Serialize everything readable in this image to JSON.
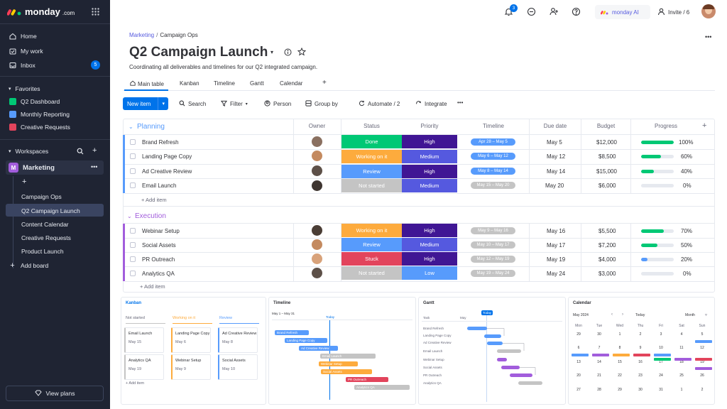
{
  "sidebar": {
    "logo": "monday",
    "logo_suffix": ".com",
    "nav": [
      {
        "label": "Home",
        "icon": "home-icon"
      },
      {
        "label": "My work",
        "icon": "calendar-check-icon"
      },
      {
        "label": "Inbox",
        "icon": "inbox-icon",
        "count": "5"
      }
    ],
    "favorites_label": "Favorites",
    "favorites": [
      {
        "label": "Q2 Dashboard",
        "color": "#00c875"
      },
      {
        "label": "Monthly Reporting",
        "color": "#579bfc"
      },
      {
        "label": "Creative Requests",
        "color": "#e2445c"
      }
    ],
    "workspaces_label": "Workspaces",
    "workspace_badge": "M",
    "workspace_name": "Marketing",
    "boards": [
      "Campaign Ops",
      "Q2 Campaign Launch",
      "Content Calendar",
      "Creative Requests",
      "Product Launch"
    ],
    "add_board": "Add board",
    "view_plans": "View plans"
  },
  "topbar": {
    "notif_count": "3",
    "ai_label": "monday AI",
    "invite_label": "Invite / 6"
  },
  "board": {
    "breadcrumb_parent": "Marketing",
    "breadcrumb_sep": "/",
    "breadcrumb_current": "Campaign Ops",
    "title": "Q2 Campaign Launch",
    "description": "Coordinating all deliverables and timelines for our Q2 integrated campaign.",
    "tabs": [
      "Main table",
      "Kanban",
      "Timeline",
      "Gantt",
      "Calendar",
      "+"
    ],
    "toolbar": {
      "new_item": "New item",
      "search": "Search",
      "filter": "Filter",
      "person": "Person",
      "group_by": "Group by",
      "automate": "Automate / 2",
      "integrate": "Integrate"
    },
    "columns": [
      "Owner",
      "Status",
      "Priority",
      "Timeline",
      "Due date",
      "Budget",
      "Progress"
    ],
    "add_item": "+ Add item",
    "groups": [
      {
        "name": "Planning",
        "color": "#579bfc",
        "rows": [
          {
            "name": "Brand Refresh",
            "status": "Done",
            "status_color": "#00c875",
            "priority": "High",
            "priority_color": "#401694",
            "timeline": "Apr 28 – May 5",
            "timeline_color": "#579bfc",
            "due": "May 5",
            "budget": "$12,000",
            "progress_label": "100%",
            "progress": 1.0
          },
          {
            "name": "Landing Page Copy",
            "status": "Working on it",
            "status_color": "#fdab3d",
            "priority": "Medium",
            "priority_color": "#5559df",
            "timeline": "May 6 – May 12",
            "timeline_color": "#579bfc",
            "due": "May 12",
            "budget": "$8,500",
            "progress_label": "60%",
            "progress": 0.6
          },
          {
            "name": "Ad Creative Review",
            "status": "Review",
            "status_color": "#579bfc",
            "priority": "High",
            "priority_color": "#401694",
            "timeline": "May 8 – May 14",
            "timeline_color": "#579bfc",
            "due": "May 14",
            "budget": "$15,000",
            "progress_label": "40%",
            "progress": 0.4
          },
          {
            "name": "Email Launch",
            "status": "Not started",
            "status_color": "#c4c4c4",
            "priority": "Medium",
            "priority_color": "#5559df",
            "timeline": "May 15 – May 20",
            "timeline_color": "#c4c4c4",
            "due": "May 20",
            "budget": "$6,000",
            "progress_label": "0%",
            "progress": 0
          }
        ]
      },
      {
        "name": "Execution",
        "color": "#a25ddc",
        "rows": [
          {
            "name": "Webinar Setup",
            "status": "Working on it",
            "status_color": "#fdab3d",
            "priority": "High",
            "priority_color": "#401694",
            "timeline": "May 9 – May 16",
            "timeline_color": "#c4c4c4",
            "due": "May 16",
            "budget": "$5,500",
            "progress_label": "70%",
            "progress": 0.7
          },
          {
            "name": "Social Assets",
            "status": "Review",
            "status_color": "#579bfc",
            "priority": "Medium",
            "priority_color": "#5559df",
            "timeline": "May 10 – May 17",
            "timeline_color": "#c4c4c4",
            "due": "May 17",
            "budget": "$7,200",
            "progress_label": "50%",
            "progress": 0.5
          },
          {
            "name": "PR Outreach",
            "status": "Stuck",
            "status_color": "#e2445c",
            "priority": "High",
            "priority_color": "#401694",
            "timeline": "May 12 – May 19",
            "timeline_color": "#c4c4c4",
            "due": "May 19",
            "budget": "$4,000",
            "progress_label": "20%",
            "progress": 0.2
          },
          {
            "name": "Analytics QA",
            "status": "Not started",
            "status_color": "#c4c4c4",
            "priority": "Low",
            "priority_color": "#579bfc",
            "timeline": "May 19 – May 24",
            "timeline_color": "#c4c4c4",
            "due": "May 24",
            "budget": "$3,000",
            "progress_label": "0%",
            "progress": 0
          }
        ]
      }
    ]
  },
  "previews": {
    "kanban": {
      "title": "Kanban",
      "columns": [
        {
          "label": "Not started",
          "color": "#676879",
          "cards": [
            {
              "name": "Email Launch",
              "date": "May 15"
            },
            {
              "name": "Analytics QA",
              "date": "May 19"
            }
          ]
        },
        {
          "label": "Working on it",
          "color": "#fdab3d",
          "cards": [
            {
              "name": "Landing Page Copy",
              "date": "May 6"
            },
            {
              "name": "Webinar Setup",
              "date": "May 9"
            }
          ]
        },
        {
          "label": "Review",
          "color": "#579bfc",
          "cards": [
            {
              "name": "Ad Creative Review",
              "date": "May 8"
            },
            {
              "name": "Social Assets",
              "date": "May 10"
            }
          ]
        }
      ],
      "add_item": "+ Add item"
    },
    "timeline": {
      "title": "Timeline",
      "range": "May 1 – May 31",
      "today": "Today",
      "bars": [
        {
          "name": "Brand Refresh",
          "color": "#579bfc"
        },
        {
          "name": "Landing Page Copy",
          "color": "#579bfc"
        },
        {
          "name": "Ad Creative Review",
          "color": "#579bfc"
        },
        {
          "name": "Email Launch",
          "color": "#c4c4c4"
        },
        {
          "name": "Webinar Setup",
          "color": "#fdab3d"
        },
        {
          "name": "Social Assets",
          "color": "#fdab3d"
        },
        {
          "name": "PR Outreach",
          "color": "#e2445c"
        },
        {
          "name": "Analytics QA",
          "color": "#c4c4c4"
        }
      ]
    },
    "gantt": {
      "title": "Gantt",
      "task_label": "Task",
      "today": "Today",
      "month": "May",
      "tasks": [
        "Brand Refresh",
        "Landing Page Copy",
        "Ad Creative Review",
        "Email Launch",
        "Webinar Setup",
        "Social Assets",
        "PR Outreach",
        "Analytics QA"
      ]
    },
    "calendar": {
      "title": "Calendar",
      "month": "May 2024",
      "today": "Today",
      "view": "Month",
      "weekdays": [
        "Mon",
        "Tue",
        "Wed",
        "Thu",
        "Fri",
        "Sat",
        "Sun"
      ],
      "days": [
        "29",
        "30",
        "1",
        "2",
        "3",
        "4",
        "5",
        "6",
        "7",
        "8",
        "9",
        "10",
        "11",
        "12",
        "13",
        "14",
        "15",
        "16",
        "17",
        "18",
        "19",
        "20",
        "21",
        "22",
        "23",
        "24",
        "25",
        "26",
        "27",
        "28",
        "29",
        "30",
        "31",
        "1",
        "2"
      ]
    }
  }
}
